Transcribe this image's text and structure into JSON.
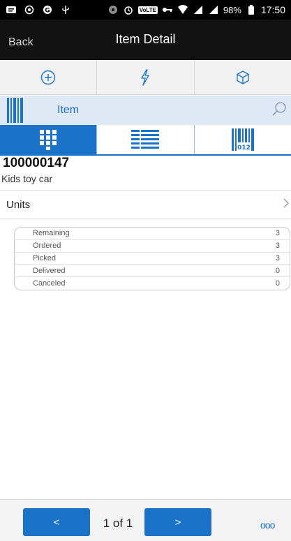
{
  "status_bar": {
    "battery": "98%",
    "time": "17:50",
    "volte": "VoLTE"
  },
  "header": {
    "back_label": "Back",
    "title": "Item Detail"
  },
  "toolbar": {
    "icons": [
      "plus-circle-icon",
      "lightning-icon",
      "cube-icon"
    ]
  },
  "scan": {
    "label": "Item"
  },
  "item": {
    "number": "100000147",
    "description": "Kids toy car"
  },
  "units": {
    "label": "Units"
  },
  "quantities": [
    {
      "label": "Remaining",
      "value": "3"
    },
    {
      "label": "Ordered",
      "value": "3"
    },
    {
      "label": "Picked",
      "value": "3"
    },
    {
      "label": "Delivered",
      "value": "0"
    },
    {
      "label": "Canceled",
      "value": "0"
    }
  ],
  "footer": {
    "prev_label": "<",
    "page_text": "1 of 1",
    "next_label": ">",
    "more_label": "ooo"
  },
  "colors": {
    "accent": "#1a73c8",
    "scanbar_bg": "#dfe9f5",
    "header_bg": "#121212"
  }
}
